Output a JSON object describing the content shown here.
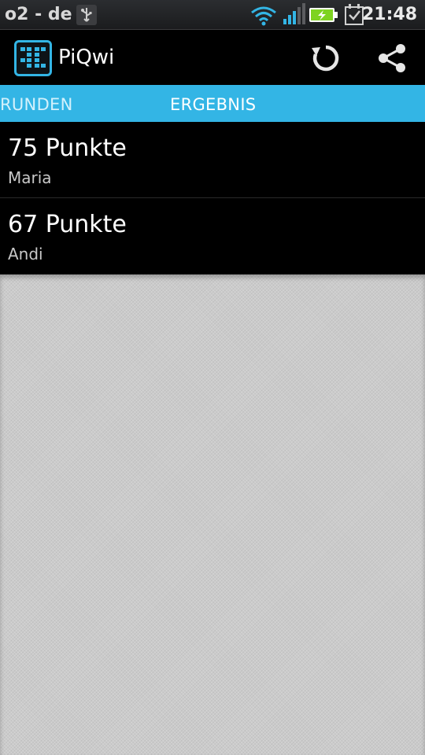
{
  "status_bar": {
    "carrier": "o2 - de",
    "time": "21:48",
    "icons": [
      "usb-icon",
      "wifi-icon",
      "signal-icon",
      "battery-charging-icon",
      "calendar-check-icon"
    ]
  },
  "action_bar": {
    "title": "PiQwi",
    "actions": [
      "refresh-icon",
      "share-icon"
    ]
  },
  "tabs": [
    {
      "label": "RUNDEN",
      "selected": false
    },
    {
      "label": "ERGEBNIS",
      "selected": true
    }
  ],
  "results": [
    {
      "score": "75 Punkte",
      "player": "Maria"
    },
    {
      "score": "67 Punkte",
      "player": "Andi"
    }
  ],
  "colors": {
    "accent": "#33b5e5",
    "battery": "#7ed321"
  }
}
